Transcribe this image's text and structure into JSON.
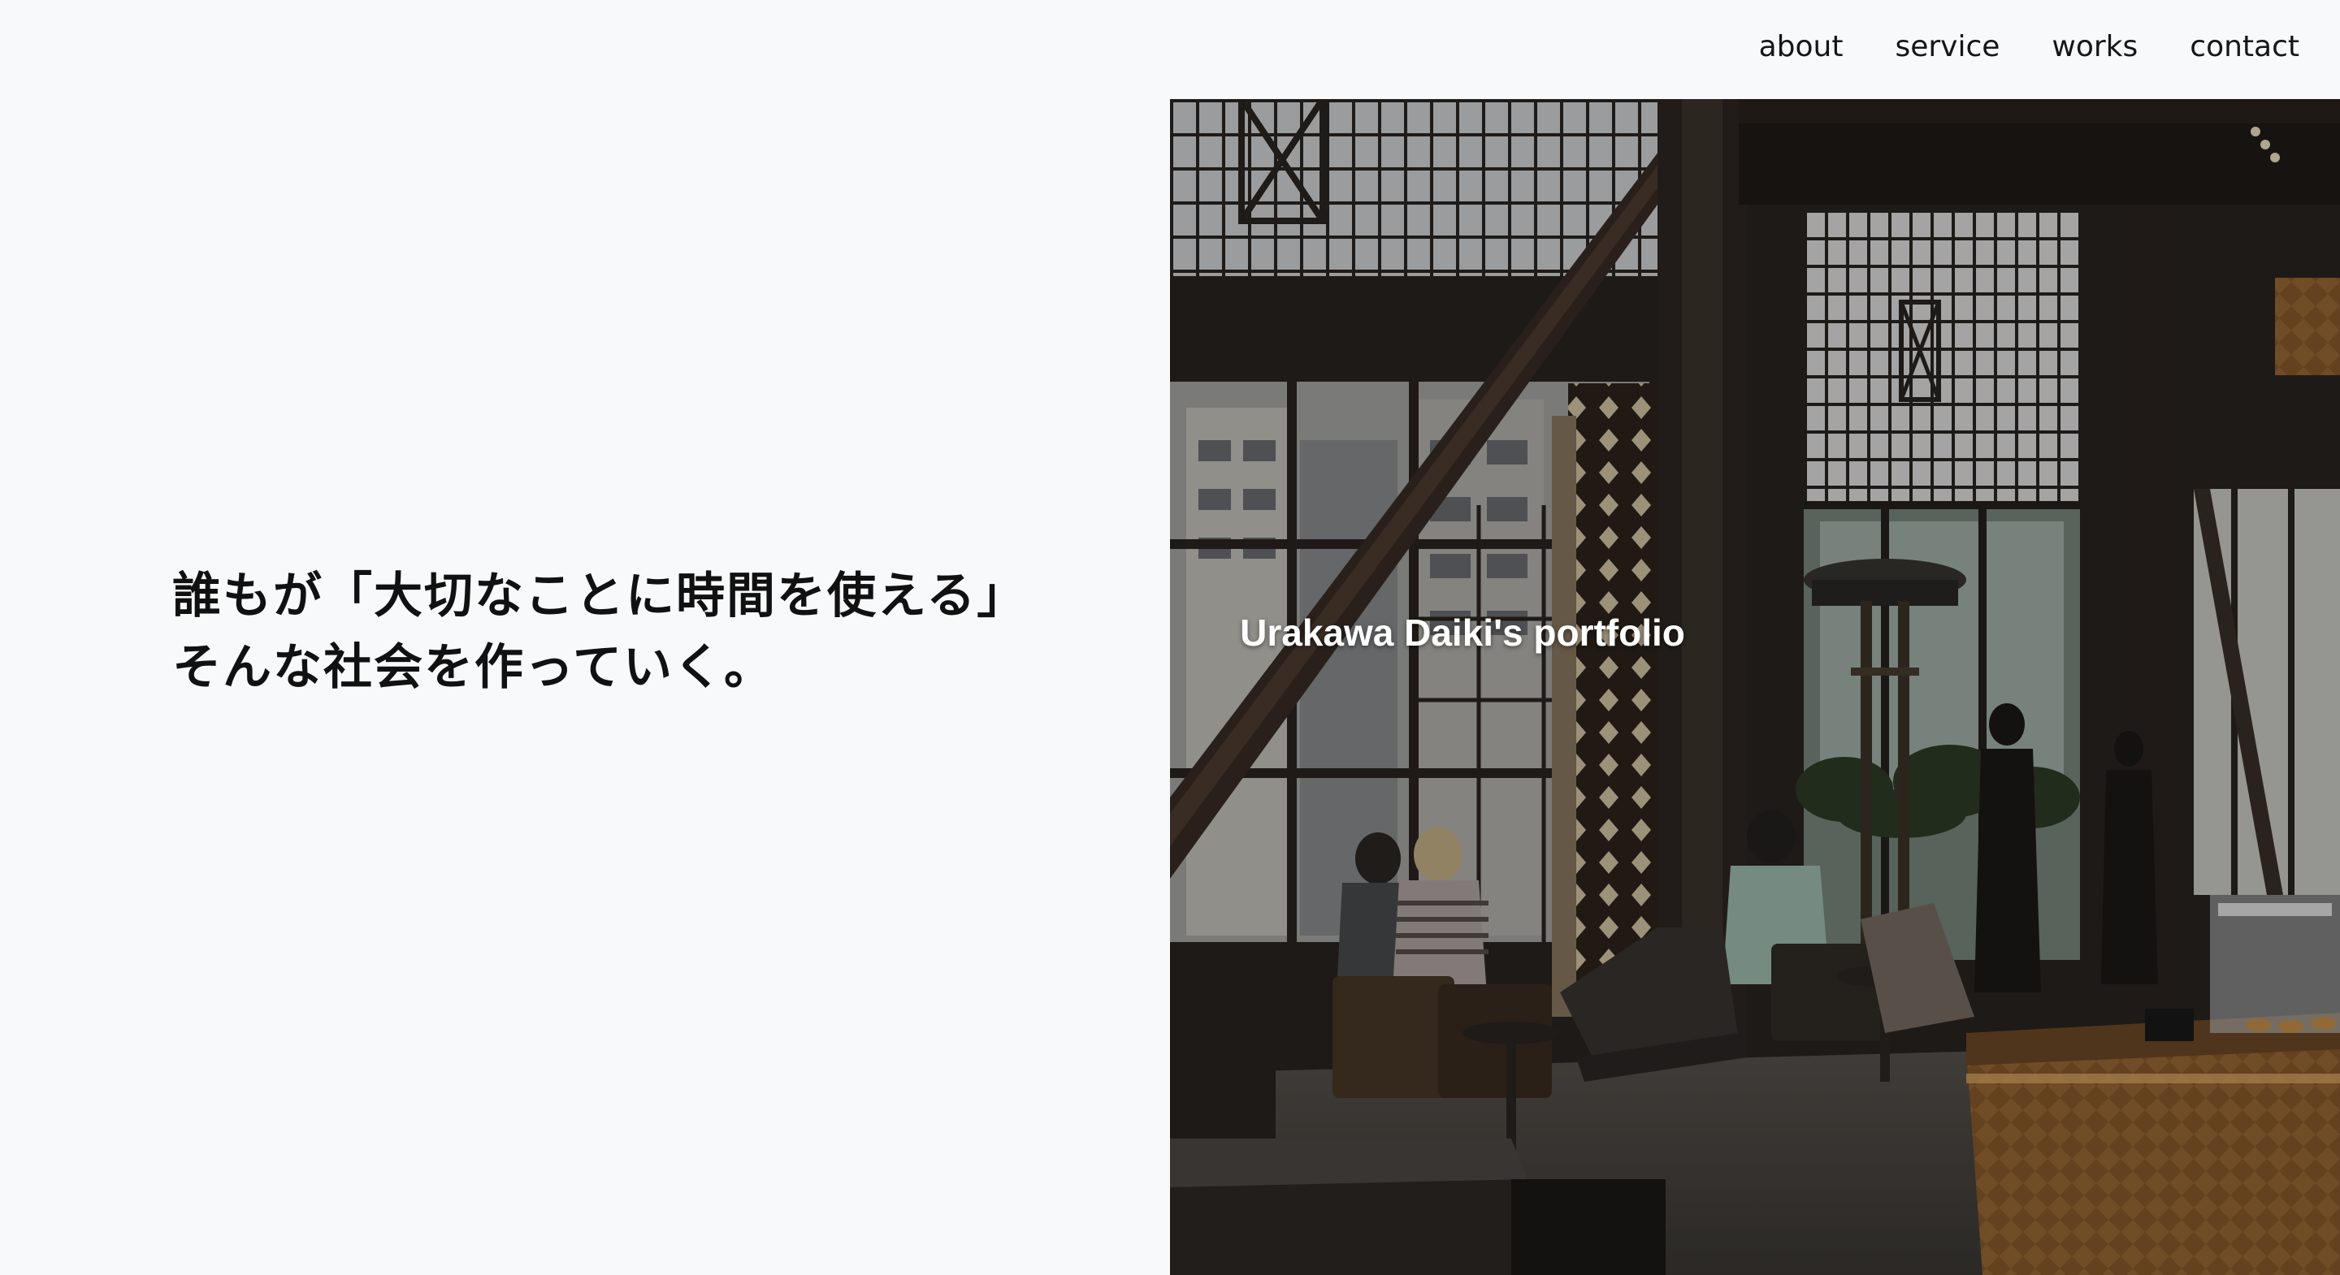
{
  "nav": {
    "items": [
      {
        "label": "about"
      },
      {
        "label": "service"
      },
      {
        "label": "works"
      },
      {
        "label": "contact"
      }
    ]
  },
  "catchphrase": {
    "line1": "誰もが「大切なことに時間を使える」",
    "line2": "そんな社会を作っていく。"
  },
  "hero": {
    "title": "Urakawa Daiki's portfolio"
  },
  "colors": {
    "background": "#f8f9fb",
    "text": "#111111",
    "hero_overlay_text": "#ffffff"
  }
}
